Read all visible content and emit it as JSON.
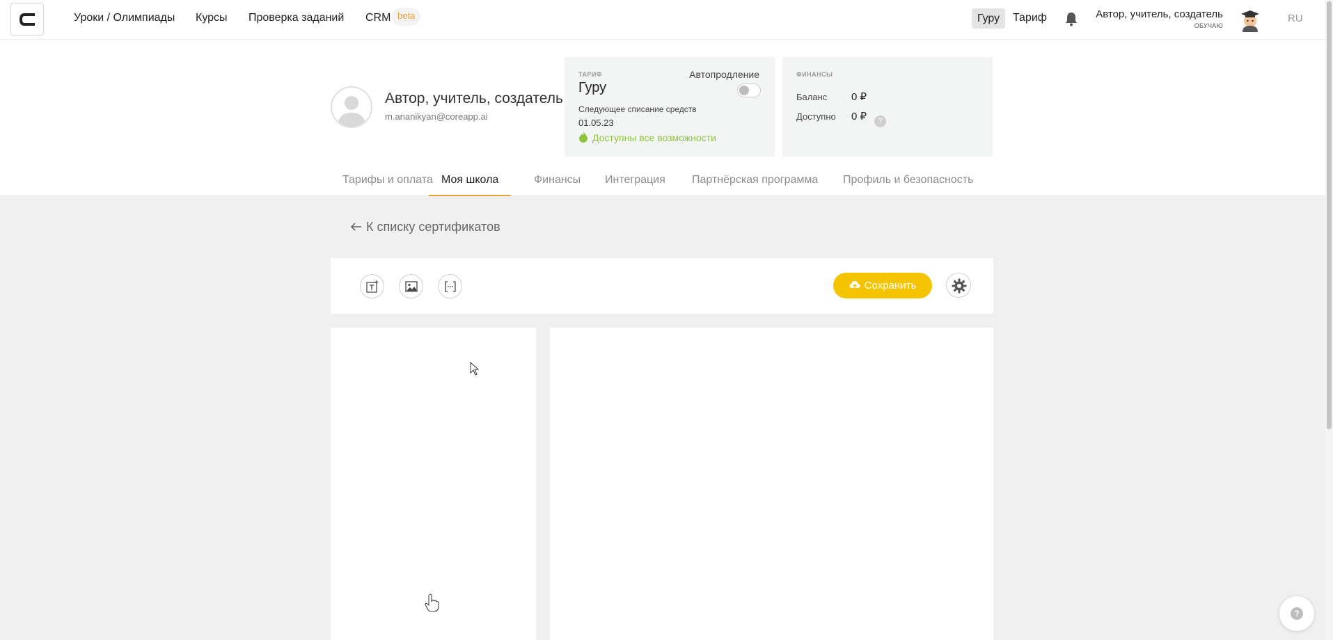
{
  "nav": {
    "links": [
      "Уроки / Олимпиады",
      "Курсы",
      "Проверка заданий",
      "CRM"
    ],
    "beta_badge": "beta",
    "plan_pill": "Гуру",
    "plan_link": "Тариф",
    "user_name": "Автор, учитель, создатель",
    "user_role": "обучаю",
    "lang": "RU"
  },
  "profile": {
    "name": "Автор, учитель, создатель",
    "email": "m.ananikyan@coreapp.ai"
  },
  "tariff_card": {
    "caption": "Тариф",
    "name": "Гуру",
    "autorenew_label": "Автопродление",
    "autorenew_on": false,
    "next_charge_label": "Следующее списание средств",
    "next_charge_date": "01.05.23",
    "features_text": "Доступны все возможности"
  },
  "finance_card": {
    "caption": "Финансы",
    "balance_label": "Баланс",
    "balance_value": "0 ₽",
    "available_label": "Доступно",
    "available_value": "0 ₽",
    "help_glyph": "?"
  },
  "tabs": [
    "Тарифы и оплата",
    "Моя школа",
    "Финансы",
    "Интеграция",
    "Партнёрская программа",
    "Профиль и безопасность"
  ],
  "active_tab": "Моя школа",
  "back_link": "К списку сертификатов",
  "toolbar": {
    "save_label": "Сохранить",
    "tools": [
      "add-text-icon",
      "image-icon",
      "placeholder-field-icon"
    ]
  },
  "help_fab": "?",
  "colors": {
    "accent": "#e9a13b",
    "save": "#f5c400",
    "features": "#8cc63f"
  }
}
